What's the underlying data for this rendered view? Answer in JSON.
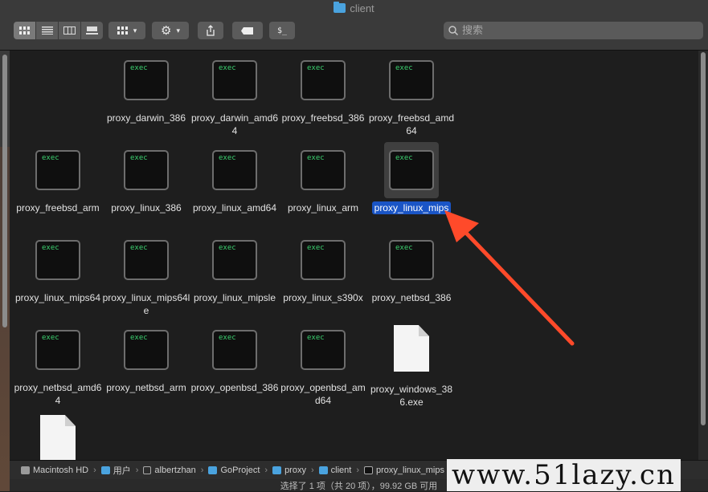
{
  "window": {
    "title": "client"
  },
  "toolbar": {
    "view_modes": [
      "icon-view",
      "list-view",
      "column-view",
      "gallery-view"
    ],
    "terminal_label": "$_"
  },
  "search": {
    "placeholder": "搜索"
  },
  "files": [
    [
      "",
      "",
      "proxy_darwin_386",
      "proxy_darwin_amd64",
      "proxy_freebsd_386",
      "proxy_freebsd_amd64"
    ],
    [
      "proxy_freebsd_arm",
      "proxy_linux_386",
      "proxy_linux_amd64",
      "proxy_linux_arm",
      "proxy_linux_mips"
    ],
    [
      "proxy_linux_mips64",
      "proxy_linux_mips64le",
      "proxy_linux_mipsle",
      "proxy_linux_s390x",
      "proxy_netbsd_386"
    ],
    [
      "proxy_netbsd_amd64",
      "proxy_netbsd_arm",
      "proxy_openbsd_386",
      "proxy_openbsd_amd64",
      "proxy_windows_386.exe"
    ]
  ],
  "items": {
    "r0c1": {
      "label": "proxy_darwin_386",
      "badge": "exec"
    },
    "r0c2": {
      "label": "proxy_darwin_amd64",
      "badge": "exec"
    },
    "r0c3": {
      "label": "proxy_freebsd_386",
      "badge": "exec"
    },
    "r0c4": {
      "label": "proxy_freebsd_amd64",
      "badge": "exec"
    },
    "r1c0": {
      "label": "proxy_freebsd_arm",
      "badge": "exec"
    },
    "r1c1": {
      "label": "proxy_linux_386",
      "badge": "exec"
    },
    "r1c2": {
      "label": "proxy_linux_amd64",
      "badge": "exec"
    },
    "r1c3": {
      "label": "proxy_linux_arm",
      "badge": "exec"
    },
    "r1c4": {
      "label": "proxy_linux_mips",
      "badge": "exec"
    },
    "r2c0": {
      "label": "proxy_linux_mips64",
      "badge": "exec"
    },
    "r2c1": {
      "label": "proxy_linux_mips64le",
      "badge": "exec"
    },
    "r2c2": {
      "label": "proxy_linux_mipsle",
      "badge": "exec"
    },
    "r2c3": {
      "label": "proxy_linux_s390x",
      "badge": "exec"
    },
    "r2c4": {
      "label": "proxy_netbsd_386",
      "badge": "exec"
    },
    "r3c0": {
      "label": "proxy_netbsd_amd64",
      "badge": "exec"
    },
    "r3c1": {
      "label": "proxy_netbsd_arm",
      "badge": "exec"
    },
    "r3c2": {
      "label": "proxy_openbsd_386",
      "badge": "exec"
    },
    "r3c3": {
      "label": "proxy_openbsd_amd64",
      "badge": "exec"
    },
    "r3c4": {
      "label": "proxy_windows_386.exe"
    }
  },
  "selected": "proxy_linux_mips",
  "pathbar": [
    "Macintosh HD",
    "用户",
    "albertzhan",
    "GoProject",
    "proxy",
    "client",
    "proxy_linux_mips"
  ],
  "status": {
    "text": "选择了 1 项（共 20 项），99.92 GB 可用"
  },
  "watermark": "www.51lazy.cn",
  "colors": {
    "selection": "#1a55c6",
    "exec_text": "#3bd16f",
    "arrow": "#ff4a2a"
  }
}
